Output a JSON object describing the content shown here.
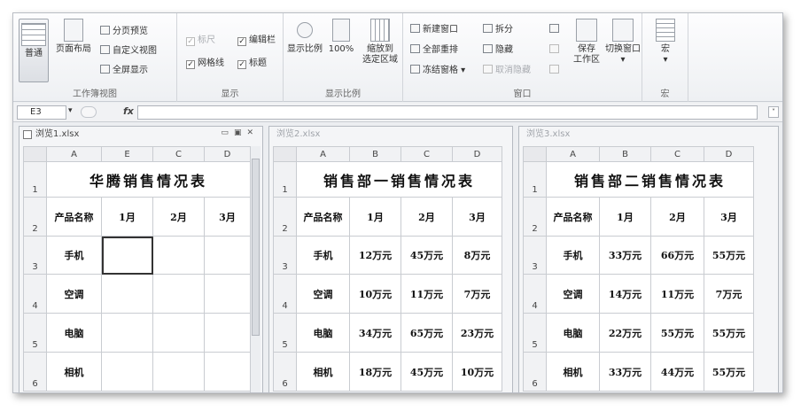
{
  "ribbon": {
    "workbook_views": {
      "title": "工作簿视图",
      "normal": "普通",
      "page_layout": "页面布局",
      "page_break_preview": "分页预览",
      "custom_views": "自定义视图",
      "full_screen": "全屏显示"
    },
    "show": {
      "title": "显示",
      "ruler": "标尺",
      "formula_bar": "编辑栏",
      "gridlines": "网格线",
      "headings": "标题"
    },
    "zoom": {
      "title": "显示比例",
      "zoom": "显示比例",
      "zoom_100": "100%",
      "zoom_to_selection_line1": "缩放到",
      "zoom_to_selection_line2": "选定区域"
    },
    "window": {
      "title": "窗口",
      "new_window": "新建窗口",
      "arrange_all": "全部重排",
      "freeze_panes": "冻结窗格",
      "split": "拆分",
      "hide": "隐藏",
      "unhide": "取消隐藏",
      "save_workspace_line1": "保存",
      "save_workspace_line2": "工作区",
      "switch_windows": "切换窗口"
    },
    "macros": {
      "title": "宏",
      "macros": "宏"
    }
  },
  "formula_bar": {
    "name_box": "E3",
    "fx": "fx",
    "value": ""
  },
  "windows": [
    {
      "title": "浏览1.xlsx",
      "active": true,
      "columns": [
        "A",
        "E",
        "C",
        "D"
      ],
      "rows": [
        "1",
        "2",
        "3",
        "4",
        "5",
        "6"
      ],
      "sheet_title": "华腾销售情况表",
      "header": [
        "产品名称",
        "1月",
        "2月",
        "3月"
      ],
      "data": [
        [
          "手机",
          "",
          "",
          ""
        ],
        [
          "空调",
          "",
          "",
          ""
        ],
        [
          "电脑",
          "",
          "",
          ""
        ],
        [
          "相机",
          "",
          "",
          ""
        ]
      ]
    },
    {
      "title": "浏览2.xlsx",
      "active": false,
      "columns": [
        "A",
        "B",
        "C",
        "D"
      ],
      "rows": [
        "1",
        "2",
        "3",
        "4",
        "5",
        "6"
      ],
      "sheet_title": "销售部一销售情况表",
      "header": [
        "产品名称",
        "1月",
        "2月",
        "3月"
      ],
      "data": [
        [
          "手机",
          "12万元",
          "45万元",
          "8万元"
        ],
        [
          "空调",
          "10万元",
          "11万元",
          "7万元"
        ],
        [
          "电脑",
          "34万元",
          "65万元",
          "23万元"
        ],
        [
          "相机",
          "18万元",
          "45万元",
          "10万元"
        ]
      ]
    },
    {
      "title": "浏览3.xlsx",
      "active": false,
      "columns": [
        "A",
        "B",
        "C",
        "D"
      ],
      "rows": [
        "1",
        "2",
        "3",
        "4",
        "5",
        "6"
      ],
      "sheet_title": "销售部二销售情况表",
      "header": [
        "产品名称",
        "1月",
        "2月",
        "3月"
      ],
      "data": [
        [
          "手机",
          "33万元",
          "66万元",
          "55万元"
        ],
        [
          "空调",
          "14万元",
          "11万元",
          "7万元"
        ],
        [
          "电脑",
          "22万元",
          "55万元",
          "55万元"
        ],
        [
          "相机",
          "33万元",
          "44万元",
          "55万元"
        ]
      ]
    }
  ]
}
